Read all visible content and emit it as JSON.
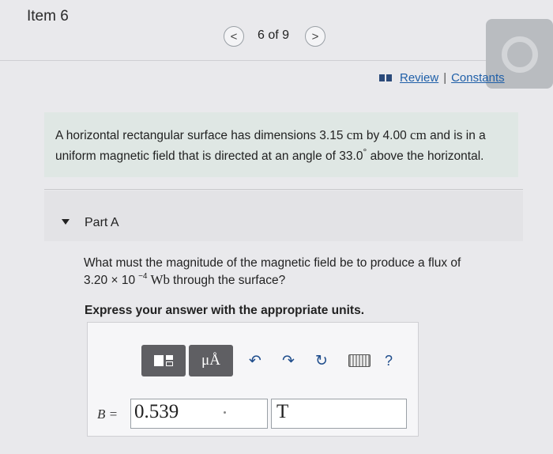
{
  "header": {
    "item_title": "Item 6",
    "nav_prev": "<",
    "nav_count": "6 of 9",
    "nav_next": ">"
  },
  "links": {
    "review": "Review",
    "separator": "|",
    "constants": "Constants"
  },
  "problem": {
    "part1": "A horizontal rectangular surface has dimensions 3.15 ",
    "unit1": "cm",
    "part2": " by 4.00 ",
    "unit2": "cm",
    "part3": " and is in a uniform magnetic field that is directed at an angle of 33.0",
    "degree": "°",
    "part4": " above the horizontal."
  },
  "part": {
    "label": "Part A"
  },
  "question": {
    "line1": "What must the magnitude of the magnetic field be to produce a flux of",
    "mantissa": "3.20 × 10",
    "exponent": "−4",
    "unit": "Wb",
    "tail": "through the surface?",
    "instruction": "Express your answer with the appropriate units."
  },
  "toolbar": {
    "units_glyph": "μÅ",
    "undo_glyph": "↶",
    "redo_glyph": "↷",
    "reset_glyph": "↻",
    "help_glyph": "?"
  },
  "answer": {
    "variable": "B =",
    "value": "0.539",
    "unit": "T"
  },
  "colors": {
    "link": "#1f5fa8",
    "problem_bg": "#dfe7e4",
    "toolbar_dark": "#5f5f63",
    "icon_blue": "#1f4d8c"
  }
}
